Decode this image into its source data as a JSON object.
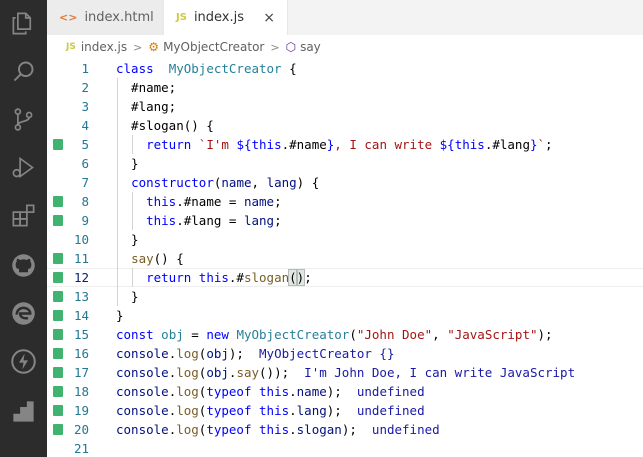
{
  "tabs": [
    {
      "icon": "<>",
      "label": "index.html",
      "active": false
    },
    {
      "icon": "JS",
      "label": "index.js",
      "active": true,
      "close": "×"
    }
  ],
  "breadcrumb": {
    "file_icon": "JS",
    "file": "index.js",
    "sep1": ">",
    "class_icon": "⚙",
    "class_name": "MyObjectCreator",
    "sep2": ">",
    "method_icon": "⬡",
    "method": "say"
  },
  "lines": [
    {
      "n": "1",
      "mark": false,
      "tokens": [
        [
          "kw",
          "class"
        ],
        [
          "",
          "  "
        ],
        [
          "cls",
          "MyObjectCreator"
        ],
        [
          "",
          " {"
        ]
      ]
    },
    {
      "n": "2",
      "mark": false,
      "tokens": [
        [
          "",
          "  #name;"
        ]
      ]
    },
    {
      "n": "3",
      "mark": false,
      "tokens": [
        [
          "",
          "  #lang;"
        ]
      ]
    },
    {
      "n": "4",
      "mark": false,
      "tokens": [
        [
          "",
          "  #slogan() {"
        ]
      ]
    },
    {
      "n": "5",
      "mark": true,
      "tokens": [
        [
          "",
          "    "
        ],
        [
          "kw",
          "return"
        ],
        [
          "",
          " "
        ],
        [
          "str",
          "`I'm "
        ],
        [
          "tmp",
          "${"
        ],
        [
          "kw",
          "this"
        ],
        [
          "",
          ".#name"
        ],
        [
          "tmp",
          "}"
        ],
        [
          "str",
          ", I can write "
        ],
        [
          "tmp",
          "${"
        ],
        [
          "kw",
          "this"
        ],
        [
          "",
          ".#lang"
        ],
        [
          "tmp",
          "}"
        ],
        [
          "str",
          "`"
        ],
        [
          "",
          ";"
        ]
      ]
    },
    {
      "n": "6",
      "mark": false,
      "tokens": [
        [
          "",
          "  }"
        ]
      ]
    },
    {
      "n": "7",
      "mark": false,
      "tokens": [
        [
          "",
          "  "
        ],
        [
          "kw",
          "constructor"
        ],
        [
          "",
          "("
        ],
        [
          "var",
          "name"
        ],
        [
          "",
          ", "
        ],
        [
          "var",
          "lang"
        ],
        [
          "",
          ") {"
        ]
      ]
    },
    {
      "n": "8",
      "mark": true,
      "tokens": [
        [
          "",
          "    "
        ],
        [
          "kw",
          "this"
        ],
        [
          "",
          ".#name = "
        ],
        [
          "var",
          "name"
        ],
        [
          "",
          ";"
        ]
      ]
    },
    {
      "n": "9",
      "mark": true,
      "tokens": [
        [
          "",
          "    "
        ],
        [
          "kw",
          "this"
        ],
        [
          "",
          ".#lang = "
        ],
        [
          "var",
          "lang"
        ],
        [
          "",
          ";"
        ]
      ]
    },
    {
      "n": "10",
      "mark": false,
      "tokens": [
        [
          "",
          "  }"
        ]
      ]
    },
    {
      "n": "11",
      "mark": true,
      "tokens": [
        [
          "",
          "  "
        ],
        [
          "fn",
          "say"
        ],
        [
          "",
          "() {"
        ]
      ]
    },
    {
      "n": "12",
      "mark": true,
      "current": true,
      "tokens": [
        [
          "",
          "    "
        ],
        [
          "kw",
          "return"
        ],
        [
          "",
          " "
        ],
        [
          "kw",
          "this"
        ],
        [
          "",
          ".#"
        ],
        [
          "fn",
          "slogan"
        ],
        [
          "br",
          "("
        ],
        [
          "br",
          ")"
        ],
        [
          "",
          ";"
        ]
      ]
    },
    {
      "n": "13",
      "mark": true,
      "tokens": [
        [
          "",
          "  }"
        ]
      ]
    },
    {
      "n": "14",
      "mark": true,
      "tokens": [
        [
          "",
          "}"
        ]
      ]
    },
    {
      "n": "15",
      "mark": true,
      "tokens": [
        [
          "kw",
          "const"
        ],
        [
          "",
          " "
        ],
        [
          "cls",
          "obj"
        ],
        [
          "",
          " = "
        ],
        [
          "kw",
          "new"
        ],
        [
          "",
          " "
        ],
        [
          "cls",
          "MyObjectCreator"
        ],
        [
          "",
          "("
        ],
        [
          "str",
          "\"John Doe\""
        ],
        [
          "",
          ", "
        ],
        [
          "str",
          "\"JavaScript\""
        ],
        [
          "",
          ");"
        ]
      ]
    },
    {
      "n": "16",
      "mark": true,
      "tokens": [
        [
          "var",
          "console"
        ],
        [
          "",
          "."
        ],
        [
          "fn",
          "log"
        ],
        [
          "",
          "("
        ],
        [
          "var",
          "obj"
        ],
        [
          "",
          ");  "
        ],
        [
          "out",
          "MyObjectCreator {}"
        ]
      ]
    },
    {
      "n": "17",
      "mark": true,
      "tokens": [
        [
          "var",
          "console"
        ],
        [
          "",
          "."
        ],
        [
          "fn",
          "log"
        ],
        [
          "",
          "("
        ],
        [
          "var",
          "obj"
        ],
        [
          "",
          "."
        ],
        [
          "fn",
          "say"
        ],
        [
          "",
          "());  "
        ],
        [
          "out",
          "I'm John Doe, I can write JavaScript"
        ]
      ]
    },
    {
      "n": "18",
      "mark": true,
      "tokens": [
        [
          "var",
          "console"
        ],
        [
          "",
          "."
        ],
        [
          "fn",
          "log"
        ],
        [
          "",
          "("
        ],
        [
          "kw",
          "typeof"
        ],
        [
          "",
          " "
        ],
        [
          "kw",
          "this"
        ],
        [
          "",
          "."
        ],
        [
          "prop",
          "name"
        ],
        [
          "",
          ");  "
        ],
        [
          "out",
          "undefined"
        ]
      ]
    },
    {
      "n": "19",
      "mark": true,
      "tokens": [
        [
          "var",
          "console"
        ],
        [
          "",
          "."
        ],
        [
          "fn",
          "log"
        ],
        [
          "",
          "("
        ],
        [
          "kw",
          "typeof"
        ],
        [
          "",
          " "
        ],
        [
          "kw",
          "this"
        ],
        [
          "",
          "."
        ],
        [
          "prop",
          "lang"
        ],
        [
          "",
          ");  "
        ],
        [
          "out",
          "undefined"
        ]
      ]
    },
    {
      "n": "20",
      "mark": true,
      "tokens": [
        [
          "var",
          "console"
        ],
        [
          "",
          "."
        ],
        [
          "fn",
          "log"
        ],
        [
          "",
          "("
        ],
        [
          "kw",
          "typeof"
        ],
        [
          "",
          " "
        ],
        [
          "kw",
          "this"
        ],
        [
          "",
          "."
        ],
        [
          "prop",
          "slogan"
        ],
        [
          "",
          ");  "
        ],
        [
          "out",
          "undefined"
        ]
      ]
    },
    {
      "n": "21",
      "mark": false,
      "tokens": []
    }
  ],
  "activity_icons": [
    "explorer-icon",
    "search-icon",
    "source-control-icon",
    "run-debug-icon",
    "extensions-icon",
    "github-icon",
    "edge-icon",
    "lightning-icon",
    "remote-icon"
  ],
  "colors": {
    "activity_bar": "#2c2c2c",
    "gutter_mark": "#3fb36f",
    "line_number": "#237893",
    "keyword": "#0000ff",
    "string": "#a31515"
  }
}
